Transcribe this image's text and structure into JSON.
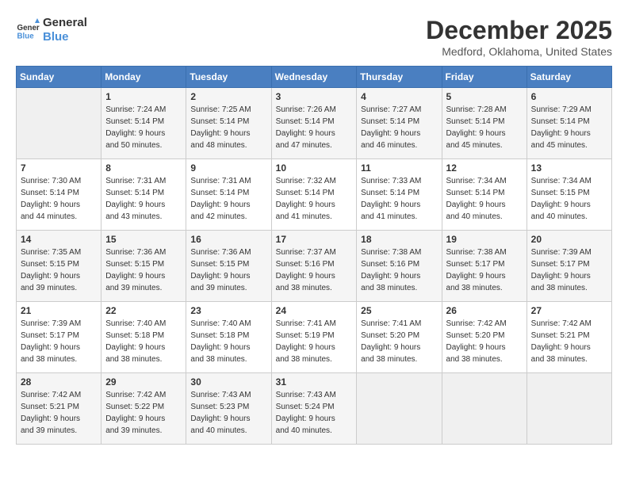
{
  "logo": {
    "line1": "General",
    "line2": "Blue"
  },
  "title": "December 2025",
  "location": "Medford, Oklahoma, United States",
  "days_header": [
    "Sunday",
    "Monday",
    "Tuesday",
    "Wednesday",
    "Thursday",
    "Friday",
    "Saturday"
  ],
  "weeks": [
    [
      {
        "day": "",
        "info": ""
      },
      {
        "day": "1",
        "info": "Sunrise: 7:24 AM\nSunset: 5:14 PM\nDaylight: 9 hours\nand 50 minutes."
      },
      {
        "day": "2",
        "info": "Sunrise: 7:25 AM\nSunset: 5:14 PM\nDaylight: 9 hours\nand 48 minutes."
      },
      {
        "day": "3",
        "info": "Sunrise: 7:26 AM\nSunset: 5:14 PM\nDaylight: 9 hours\nand 47 minutes."
      },
      {
        "day": "4",
        "info": "Sunrise: 7:27 AM\nSunset: 5:14 PM\nDaylight: 9 hours\nand 46 minutes."
      },
      {
        "day": "5",
        "info": "Sunrise: 7:28 AM\nSunset: 5:14 PM\nDaylight: 9 hours\nand 45 minutes."
      },
      {
        "day": "6",
        "info": "Sunrise: 7:29 AM\nSunset: 5:14 PM\nDaylight: 9 hours\nand 45 minutes."
      }
    ],
    [
      {
        "day": "7",
        "info": "Sunrise: 7:30 AM\nSunset: 5:14 PM\nDaylight: 9 hours\nand 44 minutes."
      },
      {
        "day": "8",
        "info": "Sunrise: 7:31 AM\nSunset: 5:14 PM\nDaylight: 9 hours\nand 43 minutes."
      },
      {
        "day": "9",
        "info": "Sunrise: 7:31 AM\nSunset: 5:14 PM\nDaylight: 9 hours\nand 42 minutes."
      },
      {
        "day": "10",
        "info": "Sunrise: 7:32 AM\nSunset: 5:14 PM\nDaylight: 9 hours\nand 41 minutes."
      },
      {
        "day": "11",
        "info": "Sunrise: 7:33 AM\nSunset: 5:14 PM\nDaylight: 9 hours\nand 41 minutes."
      },
      {
        "day": "12",
        "info": "Sunrise: 7:34 AM\nSunset: 5:14 PM\nDaylight: 9 hours\nand 40 minutes."
      },
      {
        "day": "13",
        "info": "Sunrise: 7:34 AM\nSunset: 5:15 PM\nDaylight: 9 hours\nand 40 minutes."
      }
    ],
    [
      {
        "day": "14",
        "info": "Sunrise: 7:35 AM\nSunset: 5:15 PM\nDaylight: 9 hours\nand 39 minutes."
      },
      {
        "day": "15",
        "info": "Sunrise: 7:36 AM\nSunset: 5:15 PM\nDaylight: 9 hours\nand 39 minutes."
      },
      {
        "day": "16",
        "info": "Sunrise: 7:36 AM\nSunset: 5:15 PM\nDaylight: 9 hours\nand 39 minutes."
      },
      {
        "day": "17",
        "info": "Sunrise: 7:37 AM\nSunset: 5:16 PM\nDaylight: 9 hours\nand 38 minutes."
      },
      {
        "day": "18",
        "info": "Sunrise: 7:38 AM\nSunset: 5:16 PM\nDaylight: 9 hours\nand 38 minutes."
      },
      {
        "day": "19",
        "info": "Sunrise: 7:38 AM\nSunset: 5:17 PM\nDaylight: 9 hours\nand 38 minutes."
      },
      {
        "day": "20",
        "info": "Sunrise: 7:39 AM\nSunset: 5:17 PM\nDaylight: 9 hours\nand 38 minutes."
      }
    ],
    [
      {
        "day": "21",
        "info": "Sunrise: 7:39 AM\nSunset: 5:17 PM\nDaylight: 9 hours\nand 38 minutes."
      },
      {
        "day": "22",
        "info": "Sunrise: 7:40 AM\nSunset: 5:18 PM\nDaylight: 9 hours\nand 38 minutes."
      },
      {
        "day": "23",
        "info": "Sunrise: 7:40 AM\nSunset: 5:18 PM\nDaylight: 9 hours\nand 38 minutes."
      },
      {
        "day": "24",
        "info": "Sunrise: 7:41 AM\nSunset: 5:19 PM\nDaylight: 9 hours\nand 38 minutes."
      },
      {
        "day": "25",
        "info": "Sunrise: 7:41 AM\nSunset: 5:20 PM\nDaylight: 9 hours\nand 38 minutes."
      },
      {
        "day": "26",
        "info": "Sunrise: 7:42 AM\nSunset: 5:20 PM\nDaylight: 9 hours\nand 38 minutes."
      },
      {
        "day": "27",
        "info": "Sunrise: 7:42 AM\nSunset: 5:21 PM\nDaylight: 9 hours\nand 38 minutes."
      }
    ],
    [
      {
        "day": "28",
        "info": "Sunrise: 7:42 AM\nSunset: 5:21 PM\nDaylight: 9 hours\nand 39 minutes."
      },
      {
        "day": "29",
        "info": "Sunrise: 7:42 AM\nSunset: 5:22 PM\nDaylight: 9 hours\nand 39 minutes."
      },
      {
        "day": "30",
        "info": "Sunrise: 7:43 AM\nSunset: 5:23 PM\nDaylight: 9 hours\nand 40 minutes."
      },
      {
        "day": "31",
        "info": "Sunrise: 7:43 AM\nSunset: 5:24 PM\nDaylight: 9 hours\nand 40 minutes."
      },
      {
        "day": "",
        "info": ""
      },
      {
        "day": "",
        "info": ""
      },
      {
        "day": "",
        "info": ""
      }
    ]
  ]
}
